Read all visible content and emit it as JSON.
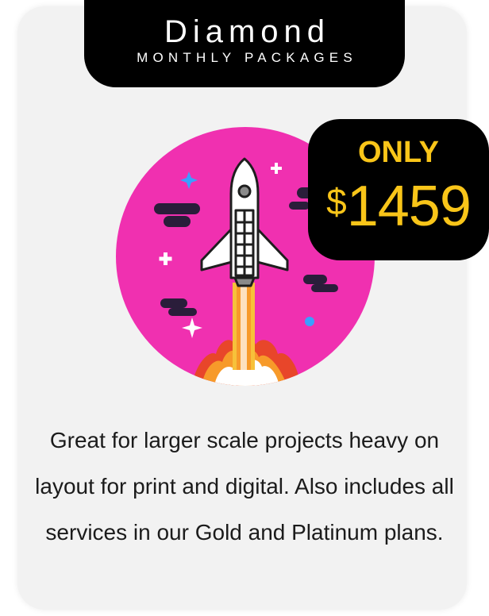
{
  "plan": {
    "name": "Diamond",
    "subtitle": "MONTHLY PACKAGES"
  },
  "price": {
    "only_label": "ONLY",
    "currency": "$",
    "amount": "1459"
  },
  "description": "Great for larger scale projects heavy on layout for print and digital. Also includes all services in our Gold and Platinum plans.",
  "illustration": {
    "icon": "rocket-launch-icon",
    "circle_color": "#f030b0"
  },
  "colors": {
    "badge_background": "#000000",
    "price_text": "#f9c519",
    "card_background": "#f2f2f2"
  }
}
